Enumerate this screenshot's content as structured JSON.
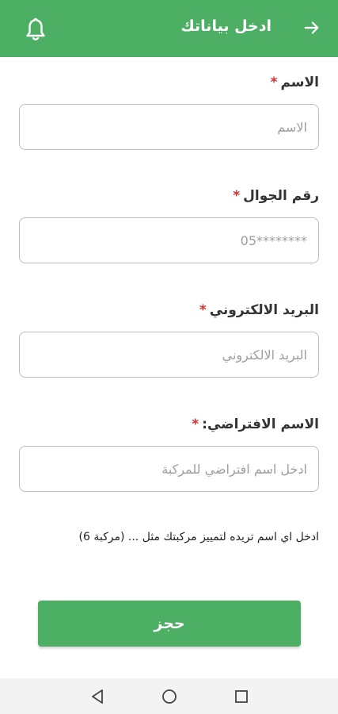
{
  "header": {
    "title": "ادخل بياناتك",
    "back_icon": "arrow-right-icon",
    "notification_icon": "bell-icon",
    "background_color": "#4caf63"
  },
  "form": {
    "name": {
      "label": "الاسم",
      "required_mark": "*",
      "placeholder": "الاسم"
    },
    "phone": {
      "label": "رقم الجوال",
      "required_mark": "*",
      "placeholder": "05********"
    },
    "email": {
      "label": "البريد الالكتروني",
      "required_mark": "*",
      "placeholder": "البريد الالكتروني"
    },
    "nickname": {
      "label": "الاسم الافتراضي:",
      "required_mark": "*",
      "placeholder": "ادخل اسم افتراضي للمركبة"
    },
    "hint": "ادخل اي اسم تريده لتمييز مركبتك مثل ... (مركبة 6)",
    "submit_label": "حجز"
  },
  "colors": {
    "primary": "#4caf63",
    "required": "#d32f2f"
  },
  "system_nav": {
    "back_icon": "triangle-back-icon",
    "home_icon": "circle-home-icon",
    "recents_icon": "square-recents-icon"
  }
}
